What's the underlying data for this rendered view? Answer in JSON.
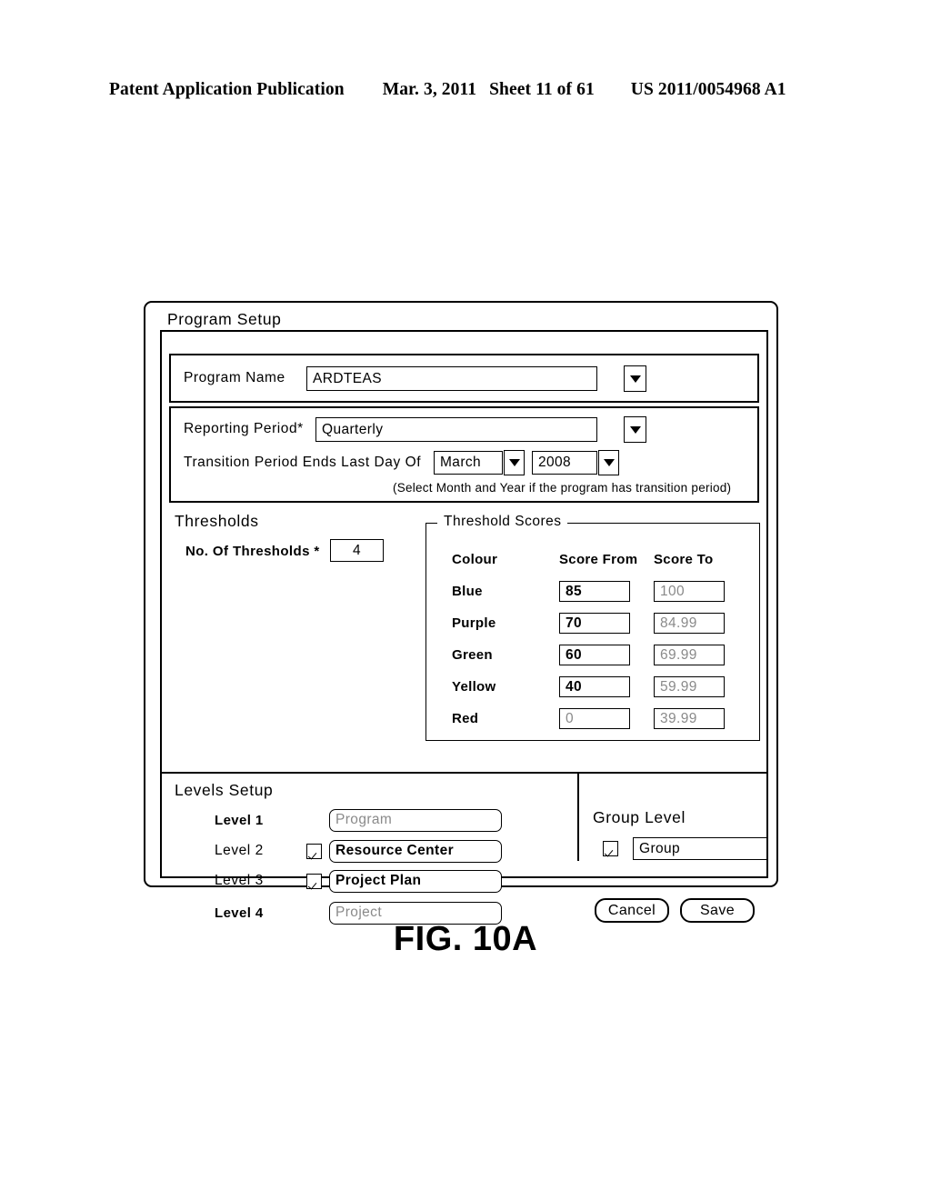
{
  "patent_header": {
    "publication": "Patent Application Publication",
    "date": "Mar. 3, 2011",
    "sheet": "Sheet 11 of 61",
    "number": "US 2011/0054968 A1"
  },
  "figure_caption": "FIG. 10A",
  "dialog": {
    "title": "Program Setup",
    "program_name": {
      "label": "Program Name",
      "value": "ARDTEAS",
      "dropdown_icon": "chevron-down-icon"
    },
    "reporting_period": {
      "label": "Reporting Period*",
      "value": "Quarterly",
      "dropdown_icon": "chevron-down-icon"
    },
    "transition_period": {
      "label": "Transition Period Ends Last Day Of",
      "month_value": "March",
      "year_value": "2008",
      "hint": "(Select Month and Year if the program has transition period)"
    },
    "thresholds": {
      "section_title": "Thresholds",
      "count_label": "No. Of Thresholds *",
      "count_value": "4",
      "scores_legend": "Threshold Scores",
      "columns": [
        "Colour",
        "Score From",
        "Score To"
      ],
      "rows": [
        {
          "colour": "Blue",
          "score_from": "85",
          "score_to": "100",
          "from_enabled": true,
          "to_enabled": false
        },
        {
          "colour": "Purple",
          "score_from": "70",
          "score_to": "84.99",
          "from_enabled": true,
          "to_enabled": false
        },
        {
          "colour": "Green",
          "score_from": "60",
          "score_to": "69.99",
          "from_enabled": true,
          "to_enabled": false
        },
        {
          "colour": "Yellow",
          "score_from": "40",
          "score_to": "59.99",
          "from_enabled": true,
          "to_enabled": false
        },
        {
          "colour": "Red",
          "score_from": "0",
          "score_to": "39.99",
          "from_enabled": false,
          "to_enabled": false
        }
      ]
    },
    "levels_setup": {
      "section_title": "Levels Setup",
      "levels": [
        {
          "label": "Level 1",
          "value": "Program",
          "checkbox": false,
          "checked": false,
          "enabled": false
        },
        {
          "label": "Level 2",
          "value": "Resource Center",
          "checkbox": true,
          "checked": true,
          "enabled": true
        },
        {
          "label": "Level 3",
          "value": "Project Plan",
          "checkbox": true,
          "checked": true,
          "enabled": true
        },
        {
          "label": "Level 4",
          "value": "Project",
          "checkbox": false,
          "checked": false,
          "enabled": false
        }
      ]
    },
    "group_level": {
      "title": "Group Level",
      "checked": true,
      "value": "Group"
    },
    "buttons": {
      "cancel": "Cancel",
      "save": "Save"
    }
  },
  "colors": {
    "ink": "#000000",
    "paper": "#ffffff",
    "disabled_text": "#8a8a8a"
  }
}
